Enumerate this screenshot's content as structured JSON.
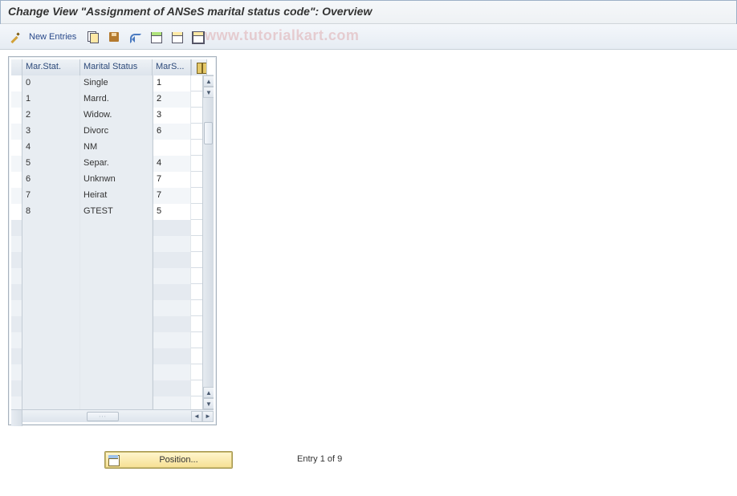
{
  "title": "Change View \"Assignment of ANSeS marital status code\": Overview",
  "watermark": "www.tutorialkart.com",
  "toolbar": {
    "new_entries": "New Entries"
  },
  "grid": {
    "headers": {
      "col_a": "Mar.Stat.",
      "col_b": "Marital Status",
      "col_c": "MarS..."
    },
    "rows": [
      {
        "a": "0",
        "b": "Single",
        "c": "1"
      },
      {
        "a": "1",
        "b": "Marrd.",
        "c": "2"
      },
      {
        "a": "2",
        "b": "Widow.",
        "c": "3"
      },
      {
        "a": "3",
        "b": "Divorc",
        "c": "6"
      },
      {
        "a": "4",
        "b": "NM",
        "c": ""
      },
      {
        "a": "5",
        "b": "Separ.",
        "c": "4"
      },
      {
        "a": "6",
        "b": "Unknwn",
        "c": "7"
      },
      {
        "a": "7",
        "b": "Heirat",
        "c": "7"
      },
      {
        "a": "8",
        "b": "GTEST",
        "c": "5"
      }
    ],
    "empty_rows": 12
  },
  "footer": {
    "position_label": "Position...",
    "entry_text": "Entry 1 of 9"
  }
}
